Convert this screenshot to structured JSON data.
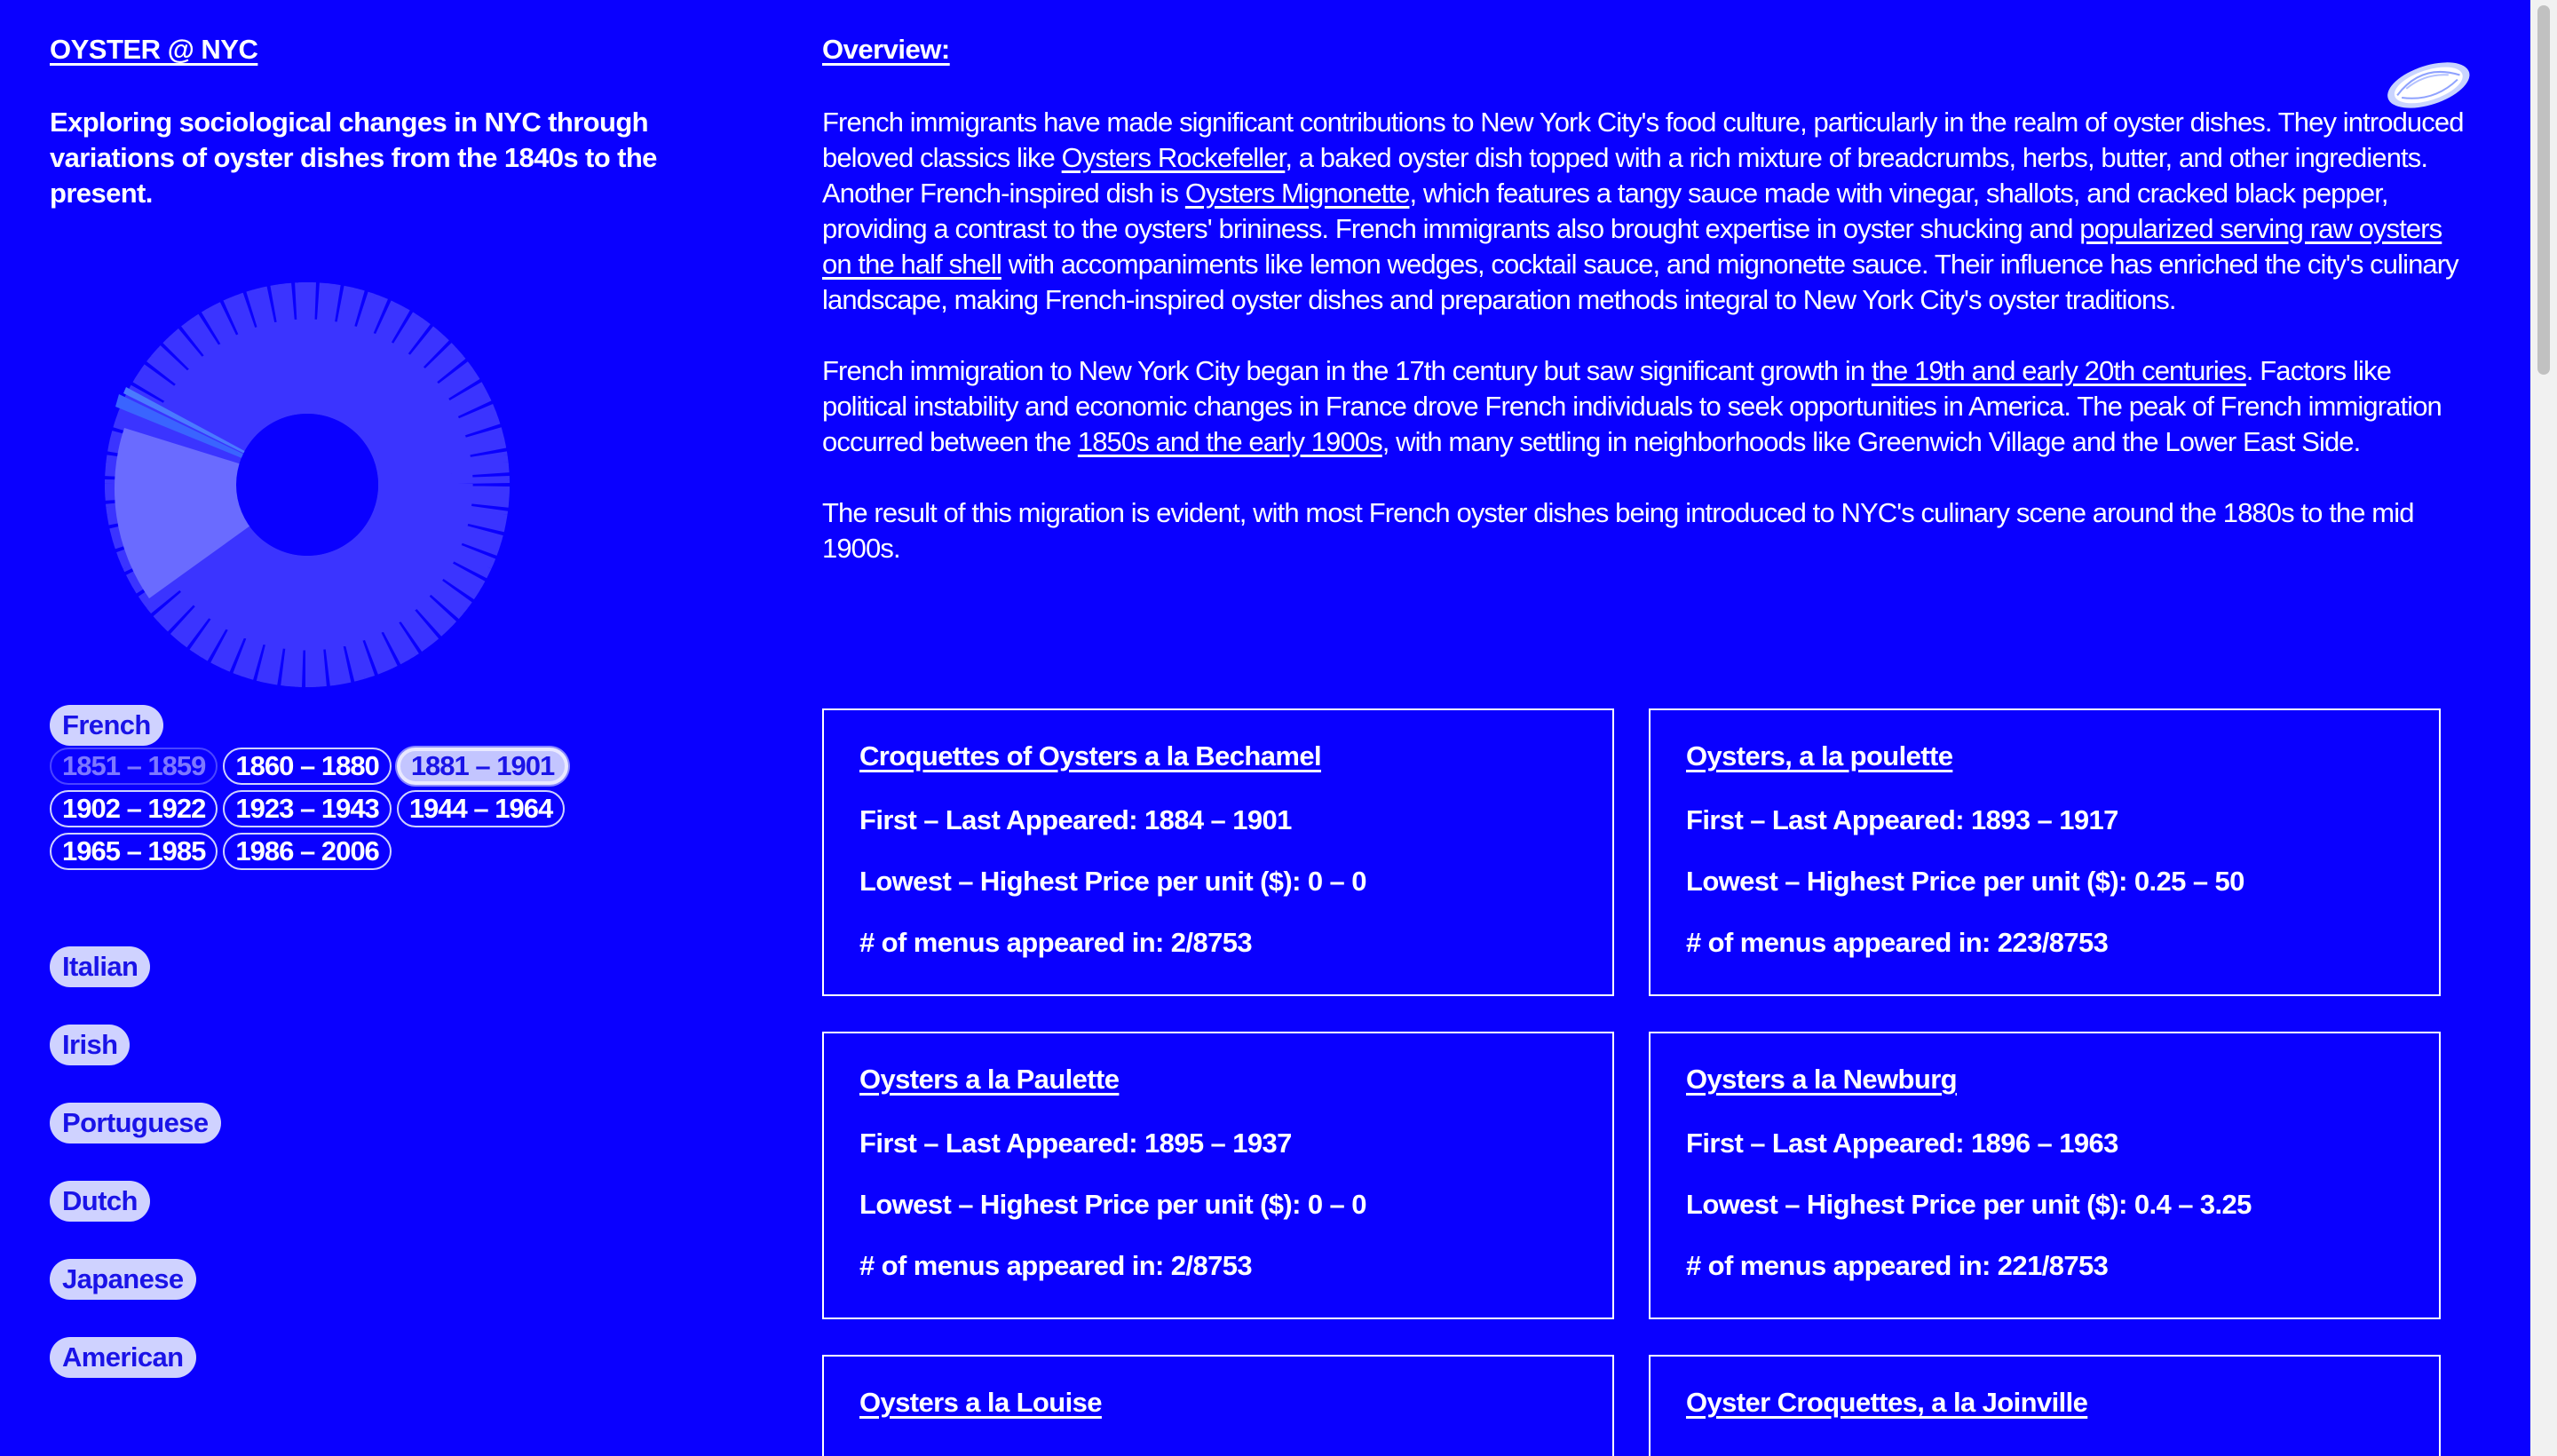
{
  "site": {
    "title": "OYSTER @ NYC",
    "tagline": "Exploring sociological changes in NYC through variations of oyster dishes from the 1840s to the present."
  },
  "colors": {
    "background": "#0a00ff",
    "pill": "#cfd2ff",
    "text": "#ffffff"
  },
  "categories": {
    "french": "French",
    "italian": "Italian",
    "irish": "Irish",
    "portuguese": "Portuguese",
    "dutch": "Dutch",
    "japanese": "Japanese",
    "american": "American"
  },
  "periods": [
    {
      "label": "1851 – 1859",
      "state": "disabled"
    },
    {
      "label": "1860 – 1880",
      "state": "normal"
    },
    {
      "label": "1881 – 1901",
      "state": "selected"
    },
    {
      "label": "1902 – 1922",
      "state": "normal"
    },
    {
      "label": "1923 – 1943",
      "state": "normal"
    },
    {
      "label": "1944 – 1964",
      "state": "normal"
    },
    {
      "label": "1965 – 1985",
      "state": "normal"
    },
    {
      "label": "1986 – 2006",
      "state": "normal"
    }
  ],
  "overview": {
    "heading": "Overview:",
    "p1": {
      "t1": "French immigrants have made significant contributions to New York City's food culture, particularly in the realm of oyster dishes. They introduced beloved classics like ",
      "l1": "Oysters Rockefeller",
      "t2": ", a baked oyster dish topped with a rich mixture of breadcrumbs, herbs, butter, and other ingredients. Another French-inspired dish is ",
      "l2": "Oysters Mignonette",
      "t3": ", which features a tangy sauce made with vinegar, shallots, and cracked black pepper, providing a contrast to the oysters' brininess. French immigrants also brought expertise in oyster shucking and ",
      "l3": "popularized serving raw oysters on the half shell",
      "t4": " with accompaniments like lemon wedges, cocktail sauce, and mignonette sauce. Their influence has enriched the city's culinary landscape, making French-inspired oyster dishes and preparation methods integral to New York City's oyster traditions."
    },
    "p2": {
      "t1": "French immigration to New York City began in the 17th century but saw significant growth in ",
      "l1": "the 19th and early 20th centuries",
      "t2": ". Factors like political instability and economic changes in France drove French individuals to seek opportunities in America. The peak of French immigration occurred between the ",
      "l2": "1850s and the early 1900s",
      "t3": ", with many settling in neighborhoods like Greenwich Village and the Lower East Side."
    },
    "p3": "The result of this migration is evident, with most French oyster dishes being introduced to NYC's culinary scene around the 1880s to the mid 1900s."
  },
  "dishes": [
    {
      "name": "Croquettes of Oysters a la Bechamel",
      "appeared": "First – Last Appeared: 1884 – 1901",
      "price": "Lowest – Highest Price per unit ($): 0 – 0",
      "menus": "# of menus appeared in: 2/8753"
    },
    {
      "name": "Oysters, a la poulette",
      "appeared": "First – Last Appeared: 1893 – 1917",
      "price": "Lowest – Highest Price per unit ($): 0.25 – 50",
      "menus": "# of menus appeared in: 223/8753"
    },
    {
      "name": "Oysters a la Paulette",
      "appeared": "First – Last Appeared: 1895 – 1937",
      "price": "Lowest – Highest Price per unit ($): 0 – 0",
      "menus": "# of menus appeared in: 2/8753"
    },
    {
      "name": "Oysters a la Newburg",
      "appeared": "First – Last Appeared: 1896 – 1963",
      "price": "Lowest – Highest Price per unit ($): 0.4 – 3.25",
      "menus": "# of menus appeared in: 221/8753"
    },
    {
      "name": "Oysters a la Louise"
    },
    {
      "name": "Oyster Croquettes, a la Joinville"
    }
  ]
}
